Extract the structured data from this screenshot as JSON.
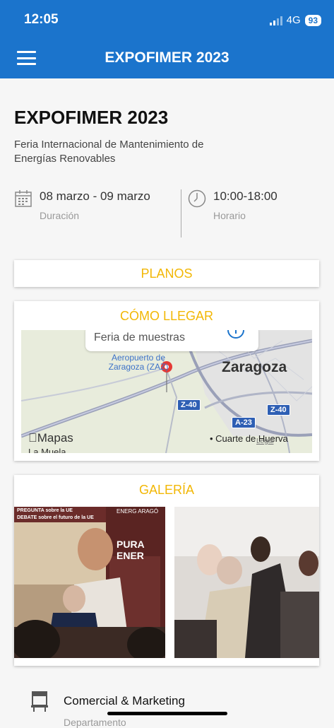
{
  "status": {
    "time": "12:05",
    "network": "4G",
    "battery": "93"
  },
  "header": {
    "title": "EXPOFIMER 2023"
  },
  "event": {
    "title": "EXPOFIMER 2023",
    "subtitle": "Feria Internacional de Mantenimiento de Energías Renovables",
    "dates": "08 marzo - 09 marzo",
    "dates_caption": "Duración",
    "hours": "10:00-18:00",
    "hours_caption": "Horario"
  },
  "planos": {
    "label": "PLANOS"
  },
  "como_llegar": {
    "label": "CÓMO LLEGAR",
    "map": {
      "callout": "Feria de muestras",
      "airport": "Aeropuerto de Zaragoza (ZAZ)",
      "city": "Zaragoza",
      "road1": "Z-40",
      "road2": "Z-40",
      "road3": "A-23",
      "town": "Cuarte de Huerva",
      "town2": "La Muela",
      "brand": "Mapas",
      "legal": "Legal"
    }
  },
  "galeria": {
    "label": "GALERÍA",
    "photo1_texts": {
      "banner1": "PREGUNTA sobre la UE",
      "banner2": "DEBATE sobre el futuro de la UE",
      "poster1": "PURA ENER",
      "poster2": "ENERG ARAGÓ"
    }
  },
  "department": {
    "title": "Comercial & Marketing",
    "caption": "Departamento"
  },
  "colors": {
    "header": "#1b74cc",
    "accent": "#f2b705"
  }
}
